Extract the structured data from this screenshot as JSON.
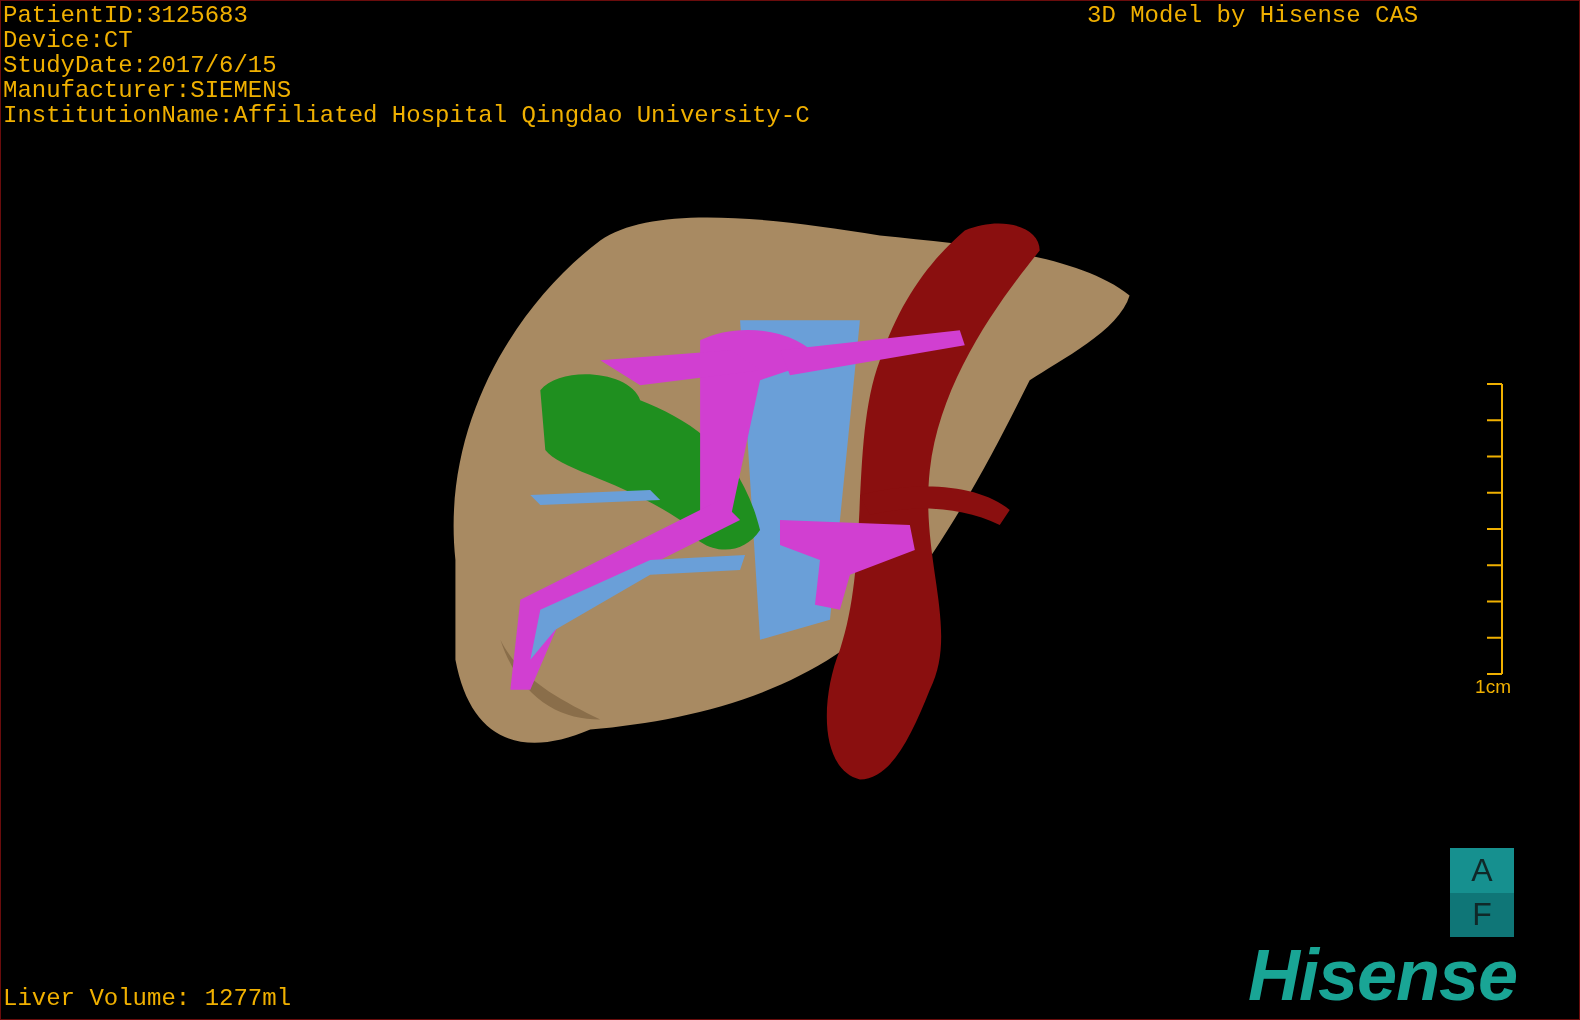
{
  "study_info": [
    "PatientID:3125683",
    "Device:CT",
    "StudyDate:2017/6/15",
    "Manufacturer:SIEMENS",
    "InstitutionName:Affiliated Hospital Qingdao University-C"
  ],
  "model_credit": "3D Model by Hisense CAS",
  "scale_bar": {
    "label": "1cm"
  },
  "orientation": {
    "top": "A",
    "bottom": "F"
  },
  "logo": "Hisense",
  "liver_volume": "Liver Volume: 1277ml"
}
